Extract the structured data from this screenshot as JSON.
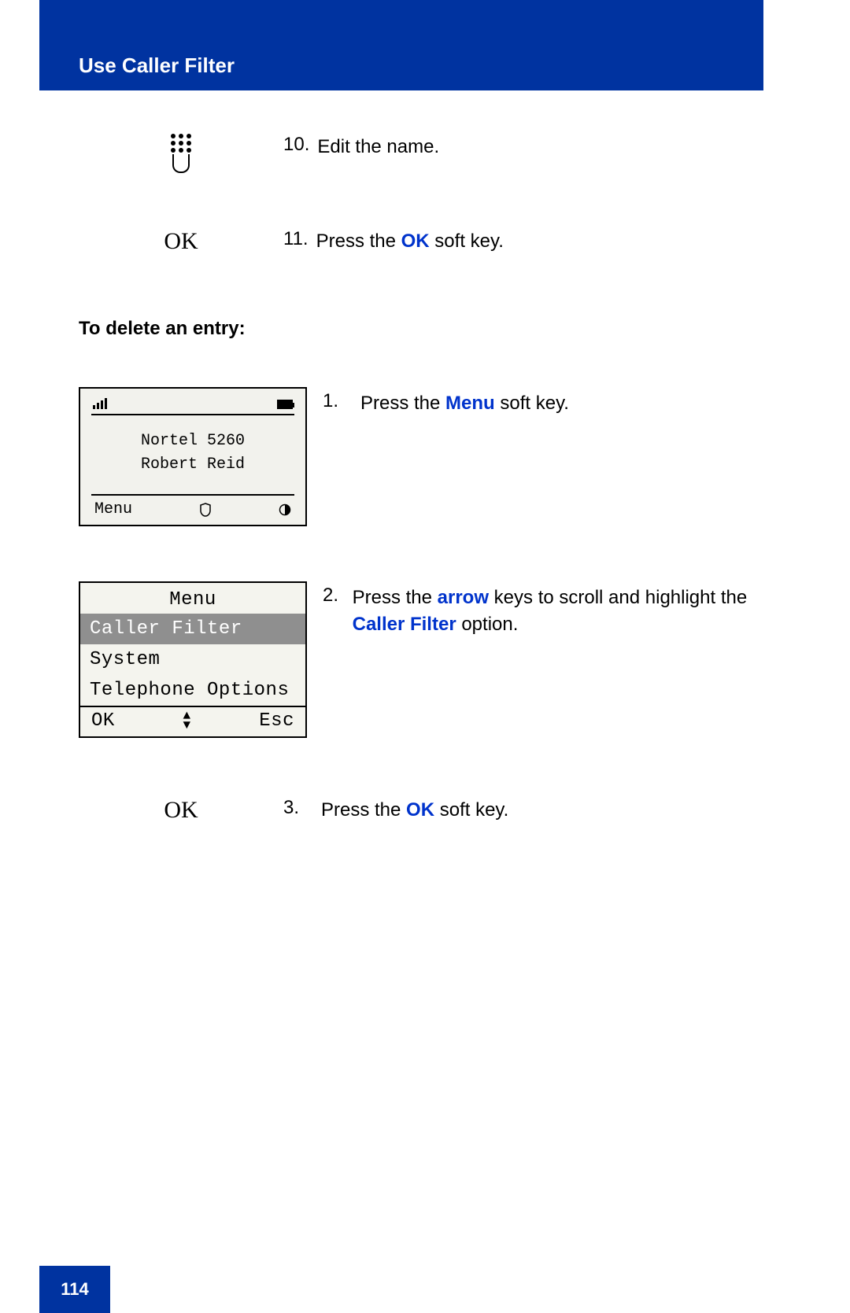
{
  "header": {
    "title": "Use Caller Filter"
  },
  "steps_top": [
    {
      "num": "10.",
      "text_parts": [
        {
          "t": "Edit the name.",
          "hl": false
        }
      ]
    },
    {
      "num": "11.",
      "text_parts": [
        {
          "t": "Press the ",
          "hl": false
        },
        {
          "t": "OK",
          "hl": true
        },
        {
          "t": " soft key.",
          "hl": false
        }
      ]
    }
  ],
  "icons": {
    "ok_label": "OK"
  },
  "section_heading": "To delete an entry:",
  "phone1": {
    "line1": "Nortel 5260",
    "line2": "Robert Reid",
    "softkey_left": "Menu"
  },
  "steps_delete": [
    {
      "num": "1.",
      "text_parts": [
        {
          "t": "Press the ",
          "hl": false
        },
        {
          "t": "Menu",
          "hl": true
        },
        {
          "t": " soft key.",
          "hl": false
        }
      ]
    },
    {
      "num": "2.",
      "text_parts": [
        {
          "t": "Press the ",
          "hl": false
        },
        {
          "t": "arrow",
          "hl": true
        },
        {
          "t": " keys to scroll and highlight the ",
          "hl": false
        },
        {
          "t": "Caller Filter",
          "hl": true
        },
        {
          "t": " option.",
          "hl": false
        }
      ]
    },
    {
      "num": "3.",
      "text_parts": [
        {
          "t": "Press the ",
          "hl": false
        },
        {
          "t": "OK",
          "hl": true
        },
        {
          "t": " soft key.",
          "hl": false
        }
      ]
    }
  ],
  "menu": {
    "title": "Menu",
    "items": [
      "Caller Filter",
      "System",
      "Telephone Options"
    ],
    "selected_index": 0,
    "footer_left": "OK",
    "footer_right": "Esc"
  },
  "page_number": "114"
}
